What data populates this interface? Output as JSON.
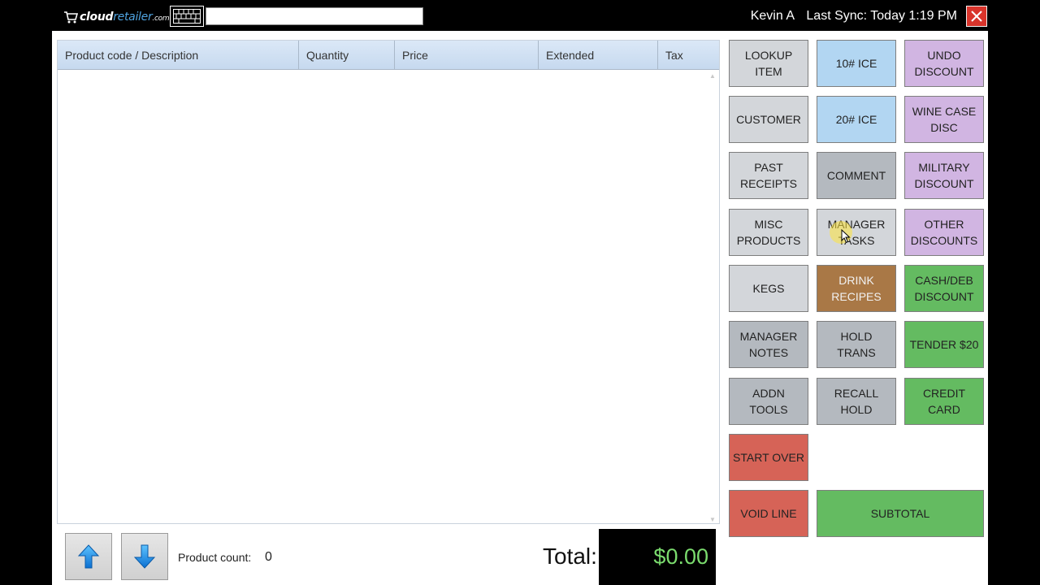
{
  "topbar": {
    "logo": {
      "brand": "cloud",
      "brand2": "retailer",
      "tld": ".com"
    },
    "keyboard_icon": "keyboard-icon",
    "scan_input_value": "",
    "user": "Kevin A",
    "sync": "Last Sync: Today 1:19 PM",
    "close_icon": "close-icon"
  },
  "grid": {
    "columns": [
      "Product code / Description",
      "Quantity",
      "Price",
      "Extended",
      "Tax"
    ],
    "rows": []
  },
  "footer": {
    "up_icon": "arrow-up-icon",
    "down_icon": "arrow-down-icon",
    "product_count_label": "Product count:",
    "product_count": "0",
    "total_label": "Total:",
    "total_value": "$0.00"
  },
  "buttons": {
    "lookup_item": "LOOKUP ITEM",
    "ice10": "10# ICE",
    "undo_discount": "UNDO DISCOUNT",
    "customer": "CUSTOMER",
    "ice20": "20# ICE",
    "wine_case_disc": "WINE CASE DISC",
    "past_receipts": "PAST RECEIPTS",
    "comment": "COMMENT",
    "military_discount": "MILITARY DISCOUNT",
    "misc_products": "MISC PRODUCTS",
    "manager_tasks": "MANAGER TASKS",
    "other_discounts": "OTHER DISCOUNTS",
    "kegs": "KEGS",
    "drink_recipes": "DRINK RECIPES",
    "cash_deb_discount": "CASH/DEB DISCOUNT",
    "manager_notes": "MANAGER NOTES",
    "hold_trans": "HOLD TRANS",
    "tender_20": "TENDER $20",
    "addn_tools": "ADDN TOOLS",
    "recall_hold": "RECALL HOLD",
    "credit_card": "CREDIT CARD",
    "start_over": "START OVER",
    "void_line": "VOID LINE",
    "subtotal": "SUBTOTAL"
  },
  "colors": {
    "gray": "#d3d6da",
    "dark_gray": "#b4b9bf",
    "blue": "#b2d6f2",
    "purple": "#d1b5e2",
    "brown": "#a97846",
    "green": "#64bb61",
    "red": "#d66357",
    "total_text": "#7bdc6e",
    "close": "#d9342b"
  }
}
